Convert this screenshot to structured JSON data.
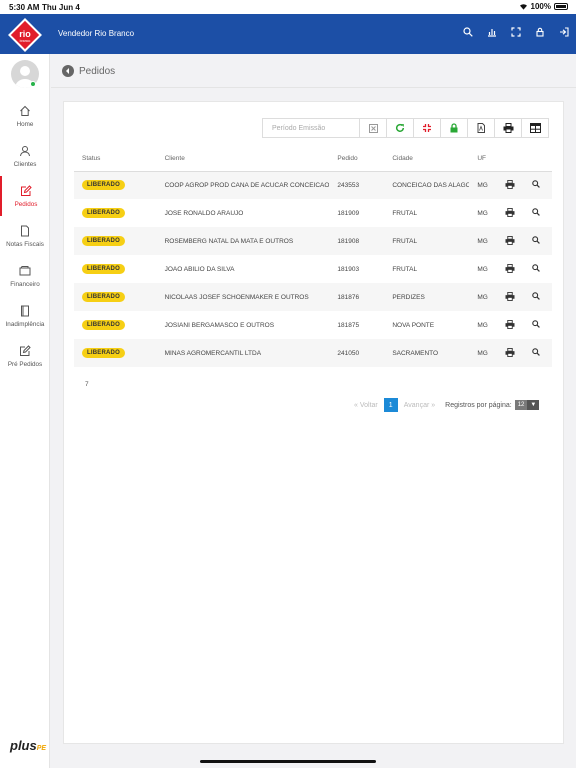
{
  "status_bar": {
    "time": "5:30 AM",
    "date": "Thu Jun 4",
    "battery": "100%"
  },
  "header": {
    "logo_text": "rio branco",
    "title": "Vendedor Rio Branco",
    "icons": [
      "search-icon",
      "chart-icon",
      "fullscreen-icon",
      "lock-icon",
      "logout-icon"
    ]
  },
  "sidebar": {
    "items": [
      {
        "label": "Home",
        "icon": "home-icon"
      },
      {
        "label": "Clientes",
        "icon": "user-icon"
      },
      {
        "label": "Pedidos",
        "icon": "edit-icon",
        "active": true
      },
      {
        "label": "Notas Fiscais",
        "icon": "document-icon"
      },
      {
        "label": "Financeiro",
        "icon": "wallet-icon"
      },
      {
        "label": "Inadimplência",
        "icon": "book-icon"
      },
      {
        "label": "Pré Pedidos",
        "icon": "edit-icon"
      }
    ],
    "footer_logo": "plus",
    "footer_logo_sub": "PE"
  },
  "page": {
    "title": "Pedidos"
  },
  "toolbar": {
    "period_placeholder": "Período Emissão"
  },
  "table": {
    "columns": [
      "Status",
      "Cliente",
      "Pedido",
      "Cidade",
      "UF"
    ],
    "rows": [
      {
        "status": "LIBERADO",
        "cliente": "COOP AGROP PROD CANA DE ACUCAR CONCEICAO",
        "pedido": "243553",
        "cidade": "CONCEICAO DAS ALAGOAS",
        "uf": "MG"
      },
      {
        "status": "LIBERADO",
        "cliente": "JOSE RONALDO ARAUJO",
        "pedido": "181909",
        "cidade": "FRUTAL",
        "uf": "MG"
      },
      {
        "status": "LIBERADO",
        "cliente": "ROSEMBERG NATAL DA MATA E OUTROS",
        "pedido": "181908",
        "cidade": "FRUTAL",
        "uf": "MG"
      },
      {
        "status": "LIBERADO",
        "cliente": "JOAO ABILIO DA SILVA",
        "pedido": "181903",
        "cidade": "FRUTAL",
        "uf": "MG"
      },
      {
        "status": "LIBERADO",
        "cliente": "NICOLAAS JOSEF SCHOENMAKER E OUTROS",
        "pedido": "181876",
        "cidade": "PERDIZES",
        "uf": "MG"
      },
      {
        "status": "LIBERADO",
        "cliente": "JOSIANI BERGAMASCO E OUTROS",
        "pedido": "181875",
        "cidade": "NOVA PONTE",
        "uf": "MG"
      },
      {
        "status": "LIBERADO",
        "cliente": "MINAS AGROMERCANTIL LTDA",
        "pedido": "241050",
        "cidade": "SACRAMENTO",
        "uf": "MG"
      }
    ],
    "total": "7"
  },
  "pagination": {
    "prev": "Voltar",
    "current": "1",
    "next": "Avançar",
    "per_page_label": "Registros por página:",
    "per_page": "12"
  },
  "colors": {
    "primary": "#1c4fa6",
    "active": "#e11d2a",
    "badge": "#f6cf14",
    "refresh": "#2aa836",
    "lock": "#2aa836"
  }
}
